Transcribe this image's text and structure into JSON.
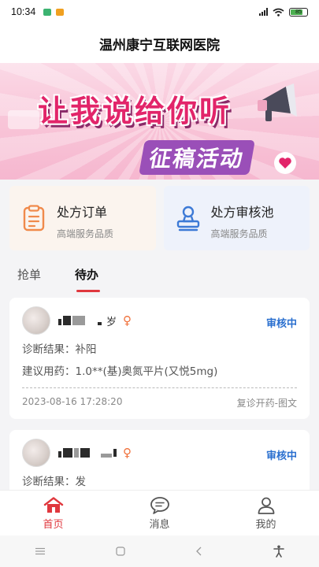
{
  "status_bar": {
    "time": "10:34",
    "battery": "85",
    "icons": [
      "signal-icon",
      "wifi-icon",
      "battery-icon"
    ]
  },
  "header": {
    "title": "温州康宁互联网医院"
  },
  "banner": {
    "line1": "让我说给你听",
    "line2": "征稿活动"
  },
  "quick_cards": [
    {
      "title": "处方订单",
      "subtitle": "高端服务品质",
      "icon": "clipboard-icon"
    },
    {
      "title": "处方审核池",
      "subtitle": "高端服务品质",
      "icon": "stamp-icon"
    }
  ],
  "tabs": [
    {
      "label": "抢单",
      "active": false
    },
    {
      "label": "待办",
      "active": true
    }
  ],
  "orders": [
    {
      "age_suffix": "岁",
      "status": "审核中",
      "diagnosis_label": "诊断结果：",
      "diagnosis": "补阳",
      "medication_label": "建议用药：",
      "medication": "1.0**(基)奥氮平片(又悦5mg)",
      "time": "2023-08-16 17:28:20",
      "type": "复诊开药-图文"
    },
    {
      "status": "审核中",
      "diagnosis_label": "诊断结果：",
      "diagnosis": "发"
    }
  ],
  "bottom_nav": [
    {
      "label": "首页",
      "icon": "home-icon",
      "active": true
    },
    {
      "label": "消息",
      "icon": "message-icon",
      "active": false
    },
    {
      "label": "我的",
      "icon": "user-icon",
      "active": false
    }
  ],
  "colors": {
    "accent": "#e0383e",
    "status": "#2a6fcf",
    "gender": "#f0703a"
  }
}
